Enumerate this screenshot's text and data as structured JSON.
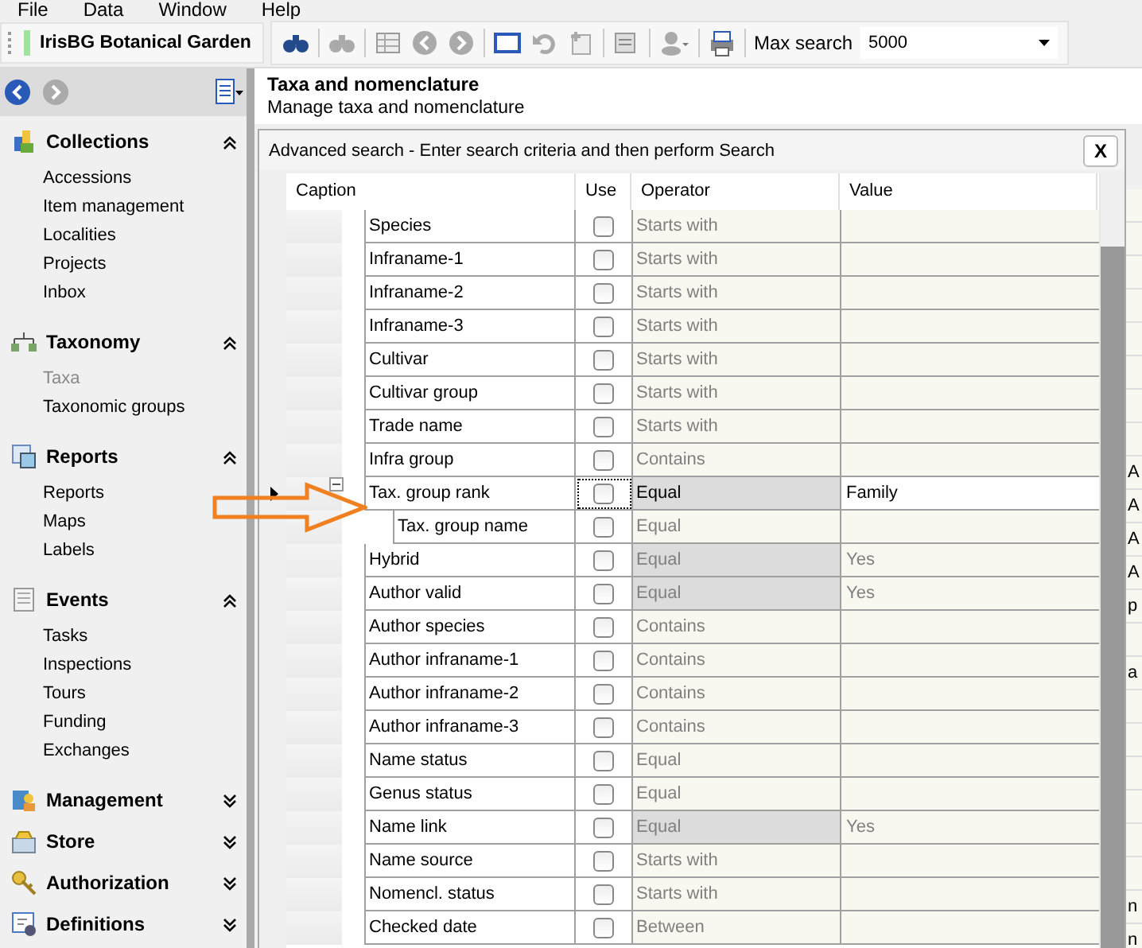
{
  "menu": [
    "File",
    "Data",
    "Window",
    "Help"
  ],
  "toolbar": {
    "app_name": "IrisBG Botanical Garden",
    "max_search_label": "Max search",
    "max_search_value": "5000"
  },
  "sidebar": {
    "groups": [
      {
        "title": "Collections",
        "expanded": true,
        "items": [
          {
            "label": "Accessions",
            "selected": false
          },
          {
            "label": "Item management",
            "selected": false
          },
          {
            "label": "Localities",
            "selected": false
          },
          {
            "label": "Projects",
            "selected": false
          },
          {
            "label": "Inbox",
            "selected": false
          }
        ]
      },
      {
        "title": "Taxonomy",
        "expanded": true,
        "items": [
          {
            "label": "Taxa",
            "selected": true
          },
          {
            "label": "Taxonomic groups",
            "selected": false
          }
        ]
      },
      {
        "title": "Reports",
        "expanded": true,
        "items": [
          {
            "label": "Reports",
            "selected": false
          },
          {
            "label": "Maps",
            "selected": false
          },
          {
            "label": "Labels",
            "selected": false
          }
        ]
      },
      {
        "title": "Events",
        "expanded": true,
        "items": [
          {
            "label": "Tasks",
            "selected": false
          },
          {
            "label": "Inspections",
            "selected": false
          },
          {
            "label": "Tours",
            "selected": false
          },
          {
            "label": "Funding",
            "selected": false
          },
          {
            "label": "Exchanges",
            "selected": false
          }
        ]
      },
      {
        "title": "Management",
        "expanded": false
      },
      {
        "title": "Store",
        "expanded": false
      },
      {
        "title": "Authorization",
        "expanded": false
      },
      {
        "title": "Definitions",
        "expanded": false
      }
    ]
  },
  "header": {
    "title": "Taxa and nomenclature",
    "subtitle": "Manage taxa and nomenclature"
  },
  "dialog": {
    "title": "Advanced search - Enter search criteria and then perform Search",
    "close": "X",
    "columns": [
      "Caption",
      "Use",
      "Operator",
      "Value"
    ],
    "rows": [
      {
        "caption": "Species",
        "checked": false,
        "operator": "Starts with",
        "operator_fixed": false,
        "selected": false
      },
      {
        "caption": "Infraname-1",
        "checked": false,
        "operator": "Starts with",
        "operator_fixed": false,
        "selected": false
      },
      {
        "caption": "Infraname-2",
        "checked": false,
        "operator": "Starts with",
        "operator_fixed": false,
        "selected": false
      },
      {
        "caption": "Infraname-3",
        "checked": false,
        "operator": "Starts with",
        "operator_fixed": false,
        "selected": false
      },
      {
        "caption": "Cultivar",
        "checked": false,
        "operator": "Starts with",
        "operator_fixed": false,
        "selected": false
      },
      {
        "caption": "Cultivar group",
        "checked": false,
        "operator": "Starts with",
        "operator_fixed": false,
        "selected": false
      },
      {
        "caption": "Trade name",
        "checked": false,
        "operator": "Starts with",
        "operator_fixed": false,
        "selected": false
      },
      {
        "caption": "Infra group",
        "checked": false,
        "operator": "Contains",
        "operator_fixed": false,
        "selected": false
      },
      {
        "caption": "Tax. group rank",
        "checked": false,
        "operator": "Equal",
        "operator_fixed": true,
        "value": "Family",
        "selected": true,
        "expanded": true,
        "children": [
          {
            "caption": "Tax. group name",
            "checked": false,
            "operator": "Equal",
            "operator_fixed": false,
            "selected": false
          }
        ]
      },
      {
        "caption": "Hybrid",
        "checked": false,
        "operator": "Equal",
        "operator_fixed": true,
        "value": "Yes",
        "selected": false
      },
      {
        "caption": "Author valid",
        "checked": false,
        "operator": "Equal",
        "operator_fixed": true,
        "value": "Yes",
        "selected": false
      },
      {
        "caption": "Author species",
        "checked": false,
        "operator": "Contains",
        "operator_fixed": false,
        "selected": false
      },
      {
        "caption": "Author infraname-1",
        "checked": false,
        "operator": "Contains",
        "operator_fixed": false,
        "selected": false
      },
      {
        "caption": "Author infraname-2",
        "checked": false,
        "operator": "Contains",
        "operator_fixed": false,
        "selected": false
      },
      {
        "caption": "Author infraname-3",
        "checked": false,
        "operator": "Contains",
        "operator_fixed": false,
        "selected": false
      },
      {
        "caption": "Name status",
        "checked": false,
        "operator": "Equal",
        "operator_fixed": false,
        "selected": false
      },
      {
        "caption": "Genus status",
        "checked": false,
        "operator": "Equal",
        "operator_fixed": false,
        "selected": false
      },
      {
        "caption": "Name link",
        "checked": false,
        "operator": "Equal",
        "operator_fixed": true,
        "value": "Yes",
        "selected": false
      },
      {
        "caption": "Name source",
        "checked": false,
        "operator": "Starts with",
        "operator_fixed": false,
        "selected": false
      },
      {
        "caption": "Nomencl. status",
        "checked": false,
        "operator": "Starts with",
        "operator_fixed": false,
        "selected": false
      },
      {
        "caption": "Checked date",
        "checked": false,
        "operator": "Between",
        "operator_fixed": false,
        "selected": false
      }
    ]
  },
  "background_rows": [
    {},
    {},
    {},
    {},
    {},
    {},
    {},
    {},
    {
      "text": "A"
    },
    {
      "text": "A"
    },
    {
      "text": "A"
    },
    {
      "text": "A"
    },
    {
      "text": "p"
    },
    {},
    {
      "text": "a"
    },
    {},
    {},
    {},
    {},
    {},
    {},
    {
      "text": "n"
    },
    {
      "text": "n"
    }
  ]
}
